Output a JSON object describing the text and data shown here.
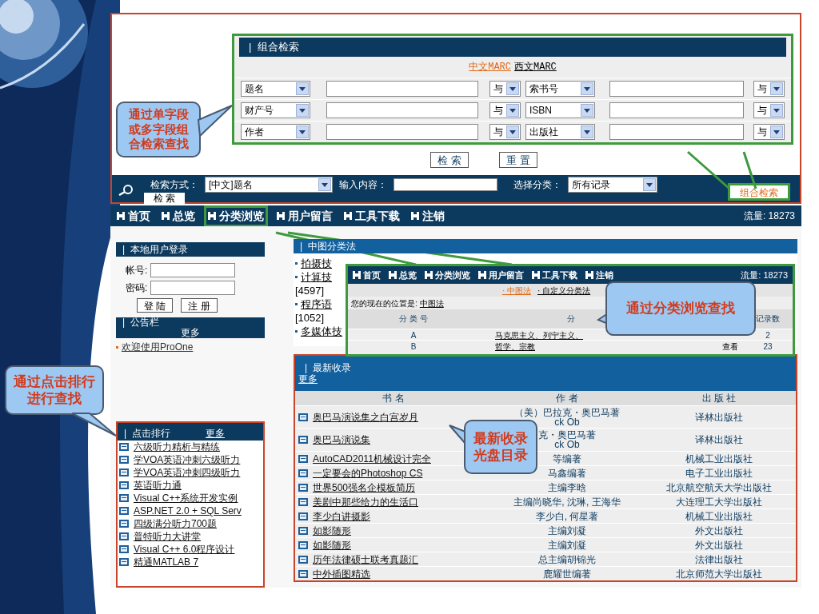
{
  "combo_search": {
    "title": "|  组合检索",
    "marc_tabs": [
      {
        "label": "中文MARC",
        "selected": true
      },
      {
        "label": "西文MARC",
        "selected": false
      }
    ],
    "rows": [
      {
        "field1": "题名",
        "op1": "与",
        "field2": "索书号",
        "op2": "与"
      },
      {
        "field1": "财产号",
        "op1": "与",
        "field2": "ISBN",
        "op2": "与"
      },
      {
        "field1": "作者",
        "op1": "与",
        "field2": "出版社",
        "op2": "与"
      }
    ],
    "buttons": [
      "检 索",
      "重 置"
    ]
  },
  "quick_search": {
    "method_label": "检索方式：",
    "method": "[中文]题名",
    "input_label": "输入内容：",
    "category_label": "选择分类：",
    "category": "所有记录",
    "search_button": "检 索",
    "combo_button": "组合检索"
  },
  "nav": {
    "items": [
      "首页",
      "总览",
      "分类浏览",
      "用户留言",
      "工具下载",
      "注销"
    ],
    "traffic": "流量: 18273"
  },
  "login": {
    "title": "|  本地用户登录",
    "account_label": "帐号:",
    "password_label": "密码:",
    "buttons": [
      "登 陆",
      "注 册"
    ]
  },
  "notice": {
    "title": "|  公告栏",
    "more": "更多",
    "items": [
      "欢迎使用ProOne"
    ]
  },
  "ranking": {
    "title": "|  点击排行",
    "more": "更多",
    "items": [
      "六级听力精析与精练",
      "学VOA英语冲刺六级听力",
      "学VOA英语冲刺四级听力",
      "英语听力通",
      "Visual C++系统开发实例",
      "ASP.NET 2.0 + SQL Serv",
      "四级满分听力700题",
      "普特听力大讲堂",
      "Visual C++ 6.0程序设计",
      "精通MATLAB 7"
    ]
  },
  "classification": {
    "title": "|  中图分类法",
    "items": [
      {
        "name": "拍摄技"
      },
      {
        "name": "计算技",
        "count": "[4597]"
      },
      {
        "name": "程序语",
        "count": "[1052]"
      },
      {
        "name": "多媒体技"
      }
    ]
  },
  "latest": {
    "title": "|  最新收录",
    "more": "更多",
    "columns": [
      "书 名",
      "作 者",
      "出 版 社"
    ],
    "rows": [
      {
        "title": "奥巴马演说集之白宫岁月",
        "author": "（美）巴拉克・奥巴马著",
        "author_2": "ck Ob",
        "publisher": "译林出版社"
      },
      {
        "title": "奥巴马演说集",
        "author": "克・奥巴马著",
        "author_2": "ck Ob",
        "publisher": "译林出版社"
      },
      {
        "title": "AutoCAD2011机械设计完全",
        "author": "等编著",
        "publisher": "机械工业出版社"
      },
      {
        "title": "一定要会的Photoshop CS",
        "author": "马鑫编著",
        "publisher": "电子工业出版社"
      },
      {
        "title": "世界500强名企模板简历",
        "author": "主编李晗",
        "publisher": "北京航空航天大学出版社"
      },
      {
        "title": "美剧中那些给力的生活口",
        "author": "主编尚晓华, 沈琳, 王海华",
        "publisher": "大连理工大学出版社"
      },
      {
        "title": "李少白讲摄影",
        "author": "李少白, 何星著",
        "publisher": "机械工业出版社"
      },
      {
        "title": "如影随形",
        "author": "主编刘凝",
        "publisher": "外文出版社"
      },
      {
        "title": "如影随形",
        "author": "主编刘凝",
        "publisher": "外文出版社"
      },
      {
        "title": "历年法律硕士联考真题汇",
        "author": "总主编胡锦光",
        "publisher": "法律出版社"
      },
      {
        "title": "中外插图精选",
        "author": "鹿耀世编著",
        "publisher": "北京师范大学出版社"
      }
    ]
  },
  "inset": {
    "nav": [
      "首页",
      "总览",
      "分类浏览",
      "用户留言",
      "工具下载",
      "注销"
    ],
    "traffic": "流量: 18273",
    "schemes": [
      {
        "label": "· 中图法",
        "selected": true
      },
      {
        "label": "· 自定义分类法",
        "selected": false
      }
    ],
    "location_label": "您的现在的位置是:",
    "location": "中图法",
    "columns": [
      "分 类 号",
      "分",
      "记录数"
    ],
    "rows": [
      {
        "code": "A",
        "name": "马克思主义、列宁主义、",
        "count": "2"
      },
      {
        "code": "B",
        "name": "哲学、宗教",
        "action": "查看",
        "count": "23"
      }
    ]
  },
  "callouts": [
    "通过单字段或多字段组合检索查找",
    "通过点击排行进行查找",
    "通过分类浏览查找",
    "最新收录光盘目录"
  ]
}
